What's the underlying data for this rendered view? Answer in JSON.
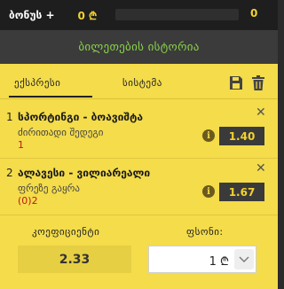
{
  "topbar": {
    "bonus_label": "ბონუს +",
    "bonus_value": "0 ₾",
    "bonus_progress": 0,
    "bonus_count": "0",
    "accent_color": "#f2d22e"
  },
  "header": {
    "title": "ბილეთების ისტორია",
    "title_color": "#8ad34a"
  },
  "slip": {
    "background_color": "#f4dc4a",
    "tabs": [
      {
        "label": "ექსპრესი",
        "active": true
      },
      {
        "label": "სისტემა",
        "active": false
      }
    ],
    "icons": [
      "save-icon",
      "trash-icon"
    ],
    "bets": [
      {
        "index": "1",
        "event": "სპორტინგი - ბოავიშტა",
        "market": "ძირითადი შედეგი",
        "selection": "1",
        "odds": "1.40",
        "info": "i"
      },
      {
        "index": "2",
        "event": "ალავესი - ვილიარეალი",
        "market": "ფრეზე გაყრა",
        "selection": "(0)2",
        "odds": "1.67",
        "info": "i"
      }
    ],
    "coefficient_label": "კოეფიციენტი",
    "coefficient_value": "2.33",
    "stake_label": "ფსონი:",
    "stake_value": "1 ₾"
  }
}
